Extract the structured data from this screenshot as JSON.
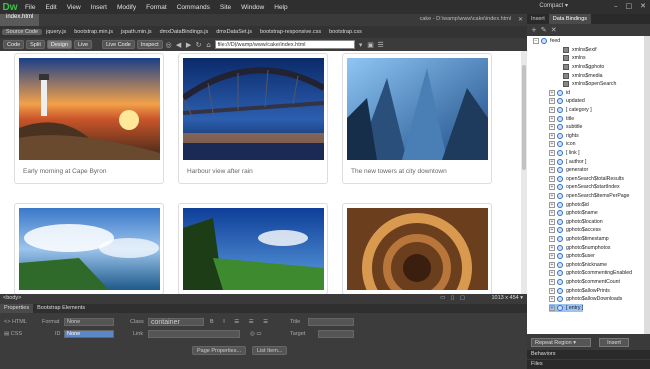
{
  "app": {
    "logo": "Dw",
    "compact": "Compact ▾"
  },
  "menu": [
    "File",
    "Edit",
    "View",
    "Insert",
    "Modify",
    "Format",
    "Commands",
    "Site",
    "Window",
    "Help"
  ],
  "document": {
    "tab": "index.html",
    "path": "cake - D:\\wamp\\www\\cake\\index.html"
  },
  "related_files": [
    "Source Code",
    "jquery.js",
    "bootstrap.min.js",
    "jspath.min.js",
    "dmxDataBindings.js",
    "dmxDataSet.js",
    "bootstrap-responsive.css",
    "bootstrap.css"
  ],
  "toolbar": {
    "views": [
      "Code",
      "Split",
      "Design",
      "Live"
    ],
    "live_code": "Live Code",
    "inspect": "Inspect",
    "address": "file:///D|/wamp/www/cake/index.html"
  },
  "cards": [
    {
      "caption": "Early morning at Cape Byron"
    },
    {
      "caption": "Harbour view after rain"
    },
    {
      "caption": "The new towers at city downtown"
    },
    {
      "caption": ""
    },
    {
      "caption": ""
    },
    {
      "caption": ""
    }
  ],
  "status": {
    "tag": "<body>",
    "size": "1013 x 454 ▾"
  },
  "properties": {
    "tabs": [
      "Properties",
      "Bootstrap Elements"
    ],
    "html": "HTML",
    "css": "CSS",
    "format_label": "Format",
    "format_value": "None",
    "class_label": "Class",
    "class_value": "container",
    "id_label": "ID",
    "id_value": "None",
    "link_label": "Link",
    "title_label": "Title",
    "target_label": "Target",
    "page_properties": "Page Properties...",
    "list_item": "List Item..."
  },
  "right_panel": {
    "tabs": [
      "Insert",
      "Data Bindings"
    ],
    "tree": [
      "feed",
      "xmlns$exif",
      "xmlns",
      "xmlns$gphoto",
      "xmlns$media",
      "xmlns$openSearch",
      "id",
      "updated",
      "[ category ]",
      "title",
      "subtitle",
      "rights",
      "icon",
      "[ link ]",
      "[ author ]",
      "generator",
      "openSearch$totalResults",
      "openSearch$startIndex",
      "openSearch$itemsPerPage",
      "gphoto$id",
      "gphoto$name",
      "gphoto$location",
      "gphoto$access",
      "gphoto$timestamp",
      "gphoto$numphotos",
      "gphoto$user",
      "gphoto$nickname",
      "gphoto$commentingEnabled",
      "gphoto$commentCount",
      "gphoto$allowPrints",
      "gphoto$allowDownloads",
      "[ entry ]"
    ],
    "repeat_region": "Repeat Region ▾",
    "insert": "Insert",
    "behaviors": "Behaviors",
    "files": "Files"
  }
}
